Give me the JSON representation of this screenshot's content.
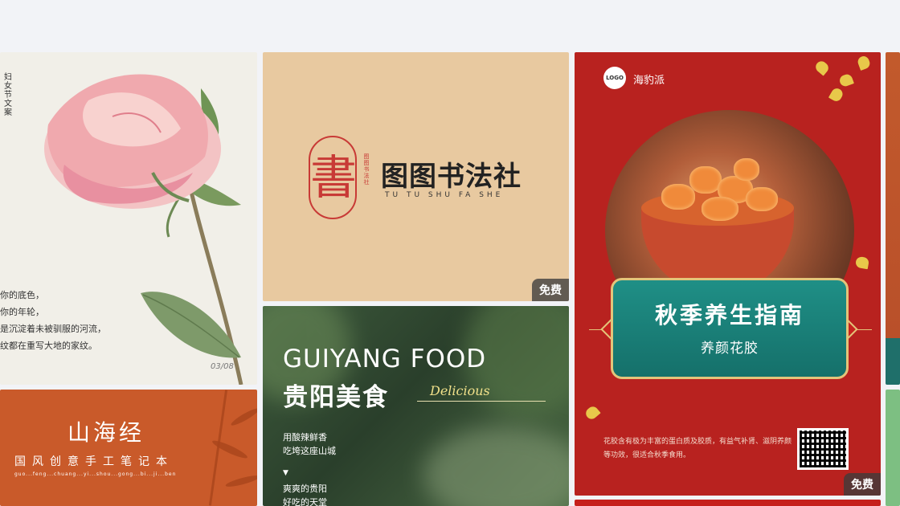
{
  "cards": {
    "peony": {
      "vertical_text": "妇女节文案",
      "poem": "你的底色，\n你的年轮，\n是沉淀着未被驯服的河流，\n纹都在重写大地的家纹。",
      "date": "03/08"
    },
    "calligraphy": {
      "seal_char": "書",
      "seal_sub": "图图书法社",
      "name": "图图书法社",
      "name_en": "TU TU SHU FA SHE",
      "badge": "免费"
    },
    "guiyang": {
      "title_en": "GUIYANG FOOD",
      "title_cn": "贵阳美食",
      "script": "Delicious",
      "line1": "用酸辣鲜香",
      "line2": "吃垮这座山城",
      "arrow": "▼",
      "line3": "爽爽的贵阳",
      "line4": "好吃的天堂"
    },
    "autumn": {
      "logo": "LOGO",
      "brand": "海豹派",
      "title": "秋季养生指南",
      "subtitle": "养颜花胶",
      "desc": "花胶含有极为丰富的蛋白质及胶质，有益气补肾、滋阴养颜等功效，很适合秋季食用。",
      "badge": "免费"
    },
    "shanhai": {
      "title": "山海经",
      "subtitle": "国风创意手工笔记本",
      "pinyin": "guo...feng...chuang...yi...shou...gong...bi...ji...ben"
    }
  },
  "colors": {
    "background": "#f2f3f7",
    "calligraphy_bg": "#e8c9a0",
    "autumn_red": "#b8221f",
    "teal_panel": "#1f8f86",
    "shanhai_orange": "#c95a2a"
  }
}
